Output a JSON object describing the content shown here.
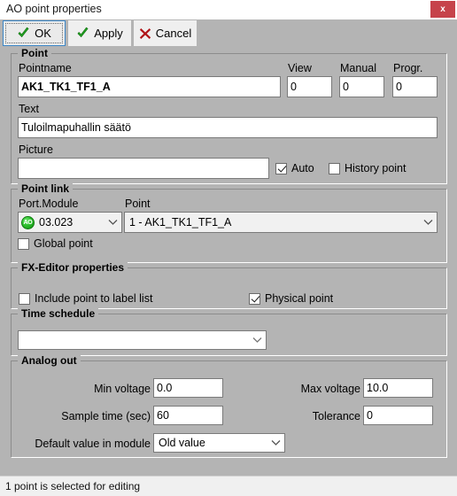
{
  "window": {
    "title": "AO point properties",
    "close_label": "x",
    "close_icon": "close-icon"
  },
  "toolbar": {
    "ok_label": "OK",
    "apply_label": "Apply",
    "cancel_label": "Cancel"
  },
  "point_group": {
    "title": "Point",
    "pointname_label": "Pointname",
    "pointname_value": "AK1_TK1_TF1_A",
    "view_label": "View",
    "view_value": "0",
    "manual_label": "Manual",
    "manual_value": "0",
    "progr_label": "Progr.",
    "progr_value": "0",
    "text_label": "Text",
    "text_value": "Tuloilmapuhallin säätö",
    "picture_label": "Picture",
    "picture_value": "",
    "auto_label": "Auto",
    "auto_checked": true,
    "history_label": "History point",
    "history_checked": false
  },
  "point_link_group": {
    "title": "Point link",
    "portmodule_label": "Port.Module",
    "portmodule_value": "03.023",
    "portmodule_badge": "AO",
    "point_label": "Point",
    "point_value": "1 - AK1_TK1_TF1_A",
    "global_label": "Global point",
    "global_checked": false
  },
  "fx_group": {
    "title": "FX-Editor properties",
    "include_label": "Include point to label list",
    "include_checked": false,
    "physical_label": "Physical point",
    "physical_checked": true
  },
  "time_group": {
    "title": "Time schedule",
    "schedule_value": ""
  },
  "analog_group": {
    "title": "Analog out",
    "min_voltage_label": "Min voltage",
    "min_voltage_value": "0.0",
    "max_voltage_label": "Max voltage",
    "max_voltage_value": "10.0",
    "sample_time_label": "Sample time (sec)",
    "sample_time_value": "60",
    "tolerance_label": "Tolerance",
    "tolerance_value": "0",
    "default_value_label": "Default value in module",
    "default_value_value": "Old value"
  },
  "statusbar": {
    "text": "1 point is selected for editing"
  },
  "colors": {
    "dialog_bg": "#b4b4b4",
    "close_red": "#c6434b",
    "focus_blue": "#3c87c8",
    "check_green": "#22a122",
    "cancel_red": "#b01418"
  }
}
